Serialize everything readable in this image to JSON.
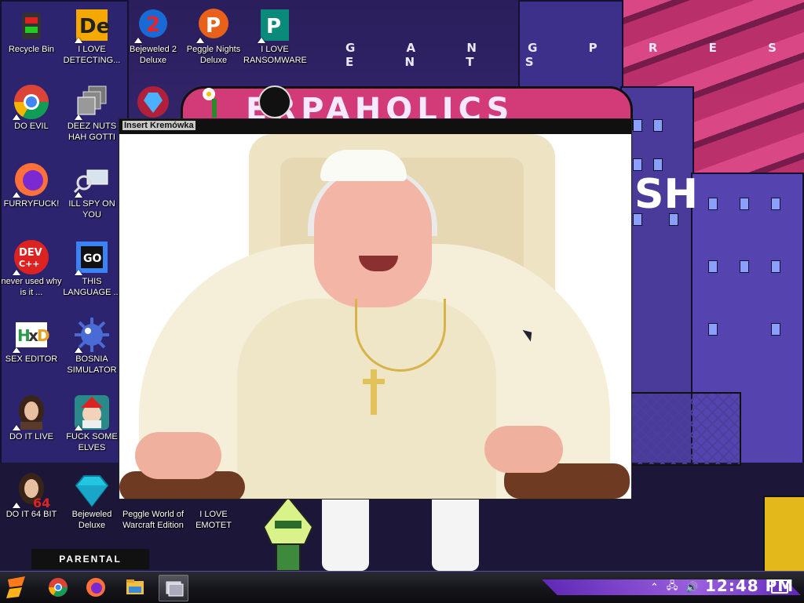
{
  "wallpaper": {
    "presents_text": "G A N G  P R E S E N T S",
    "logo_fragment": "ERPAHOLICS",
    "sh_fragment": "SH",
    "advisory_text": "PARENTAL ADVISORY",
    "accent_color": "#d23a78"
  },
  "desktop_icons": [
    {
      "label": "Recycle Bin",
      "icon": "recycle-bin-icon"
    },
    {
      "label": "I LOVE DETECTING...",
      "icon": "detect-it-easy-icon"
    },
    {
      "label": "Bejeweled 2 Deluxe",
      "icon": "bejeweled-2-icon"
    },
    {
      "label": "Peggle Nights Deluxe",
      "icon": "peggle-nights-icon"
    },
    {
      "label": "I LOVE RANSOMWARE",
      "icon": "publisher-icon"
    },
    {
      "label": "DO EVIL",
      "icon": "chrome-icon"
    },
    {
      "label": "DEEZ NUTS HAH GOTTI",
      "icon": "copy-windows-icon"
    },
    {
      "label": "FURRYFUCK!",
      "icon": "firefox-icon"
    },
    {
      "label": "ILL SPY ON YOU",
      "icon": "spy-magnifier-icon"
    },
    {
      "label": "never used why is it ...",
      "icon": "dev-cpp-icon"
    },
    {
      "label": "THIS LANGUAGE ...",
      "icon": "goland-icon"
    },
    {
      "label": "SEX EDITOR",
      "icon": "hxd-icon"
    },
    {
      "label": "BOSNIA SIMULATOR",
      "icon": "mine-icon"
    },
    {
      "label": "DO IT LIVE",
      "icon": "portrait-icon"
    },
    {
      "label": "FUCK SOME ELVES",
      "icon": "elf-game-icon"
    },
    {
      "label": "DO IT 64 BIT",
      "icon": "portrait-64-icon"
    },
    {
      "label": "Bejeweled Deluxe",
      "icon": "diamond-icon"
    },
    {
      "label": "Peggle World of Warcraft Edition",
      "icon": "peggle-wow-icon"
    },
    {
      "label": "I LOVE EMOTET",
      "icon": "emotet-icon"
    }
  ],
  "viewer": {
    "title": "Insert Kremówka"
  },
  "taskbar": {
    "start_icon": "start-icon",
    "pinned": [
      "chrome-icon",
      "firefox-icon",
      "file-explorer-icon",
      "image-viewer-icon"
    ],
    "tray_icons": [
      "chevron-up-icon",
      "network-icon",
      "volume-icon"
    ],
    "clock": "12:48 PM",
    "notification_icon": "notification-icon"
  }
}
